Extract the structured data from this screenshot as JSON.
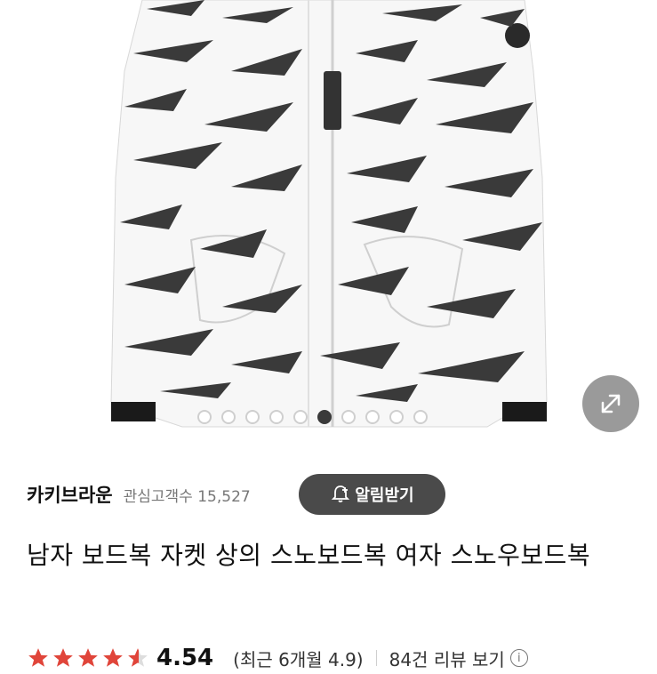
{
  "gallery": {
    "image_alt": "white tiger-stripe camo snowboard jacket",
    "dot_count": 10,
    "active_dot_index": 5,
    "expand_icon": "expand-arrows-icon"
  },
  "seller": {
    "name": "카키브라운",
    "followers_label": "관심고객수 15,527"
  },
  "alarm": {
    "label": "알림받기",
    "icon": "bell-plus-icon"
  },
  "product": {
    "title": "남자 보드복 자켓 상의 스노보드복 여자 스노우보드복"
  },
  "rating": {
    "stars": 4.54,
    "value": "4.54",
    "recent": "(최근 6개월 4.9)",
    "reviews": "84건 리뷰 보기",
    "star_color": "#e0453a"
  }
}
